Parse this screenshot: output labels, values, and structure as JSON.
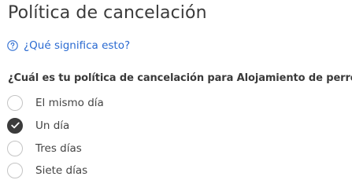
{
  "heading": "Política de cancelación",
  "help_link": {
    "icon": "question-circle-icon",
    "label": "¿Qué significa esto?",
    "color": "#2a6ad1"
  },
  "question": "¿Cuál es tu política de cancelación para Alojamiento de perros?",
  "options": [
    {
      "label": "El mismo día",
      "selected": false
    },
    {
      "label": "Un día",
      "selected": true
    },
    {
      "label": "Tres días",
      "selected": false
    },
    {
      "label": "Siete días",
      "selected": false
    }
  ],
  "colors": {
    "text": "#3a3a3a",
    "link": "#2a6ad1",
    "radio_selected": "#3b3b3b",
    "radio_border": "#c4c4c4"
  }
}
